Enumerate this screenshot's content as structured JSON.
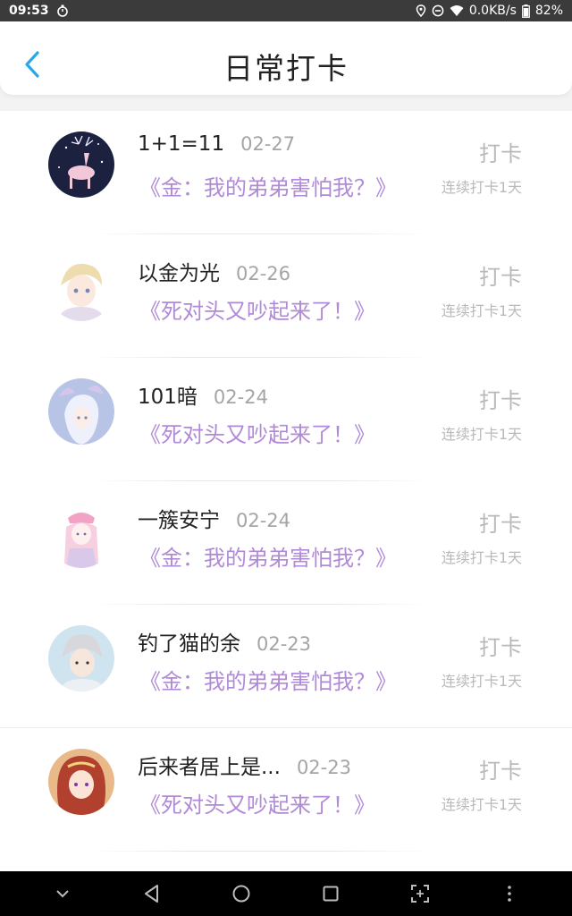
{
  "status": {
    "time": "09:53",
    "net_speed": "0.0KB/s",
    "battery": "82%"
  },
  "header": {
    "title": "日常打卡"
  },
  "entries": [
    {
      "name": "1+1=11",
      "date": "02-27",
      "book": "《金：我的弟弟害怕我？》",
      "checkin_label": "打卡",
      "streak": "连续打卡1天"
    },
    {
      "name": "以金为光",
      "date": "02-26",
      "book": "《死对头又吵起来了！》",
      "checkin_label": "打卡",
      "streak": "连续打卡1天"
    },
    {
      "name": "101暗",
      "date": "02-24",
      "book": "《死对头又吵起来了！》",
      "checkin_label": "打卡",
      "streak": "连续打卡1天"
    },
    {
      "name": "一簇安宁",
      "date": "02-24",
      "book": "《金：我的弟弟害怕我？》",
      "checkin_label": "打卡",
      "streak": "连续打卡1天"
    },
    {
      "name": "钓了猫的余",
      "date": "02-23",
      "book": "《金：我的弟弟害怕我？》",
      "checkin_label": "打卡",
      "streak": "连续打卡1天"
    },
    {
      "name": "后来者居上是...",
      "date": "02-23",
      "book": "《死对头又吵起来了！》",
      "checkin_label": "打卡",
      "streak": "连续打卡1天"
    }
  ],
  "colors": {
    "accent": "#2aa8e8",
    "book_title": "#b08ad6",
    "muted": "#b9b9b9"
  },
  "icons": {
    "status_left": [
      "stopwatch-icon"
    ],
    "status_right": [
      "location-icon",
      "do-not-disturb-icon",
      "wifi-icon",
      "battery-icon"
    ],
    "nav": [
      "chevron-down-icon",
      "back-triangle-icon",
      "home-circle-icon",
      "recents-square-icon",
      "scan-icon",
      "more-dots-icon"
    ]
  }
}
